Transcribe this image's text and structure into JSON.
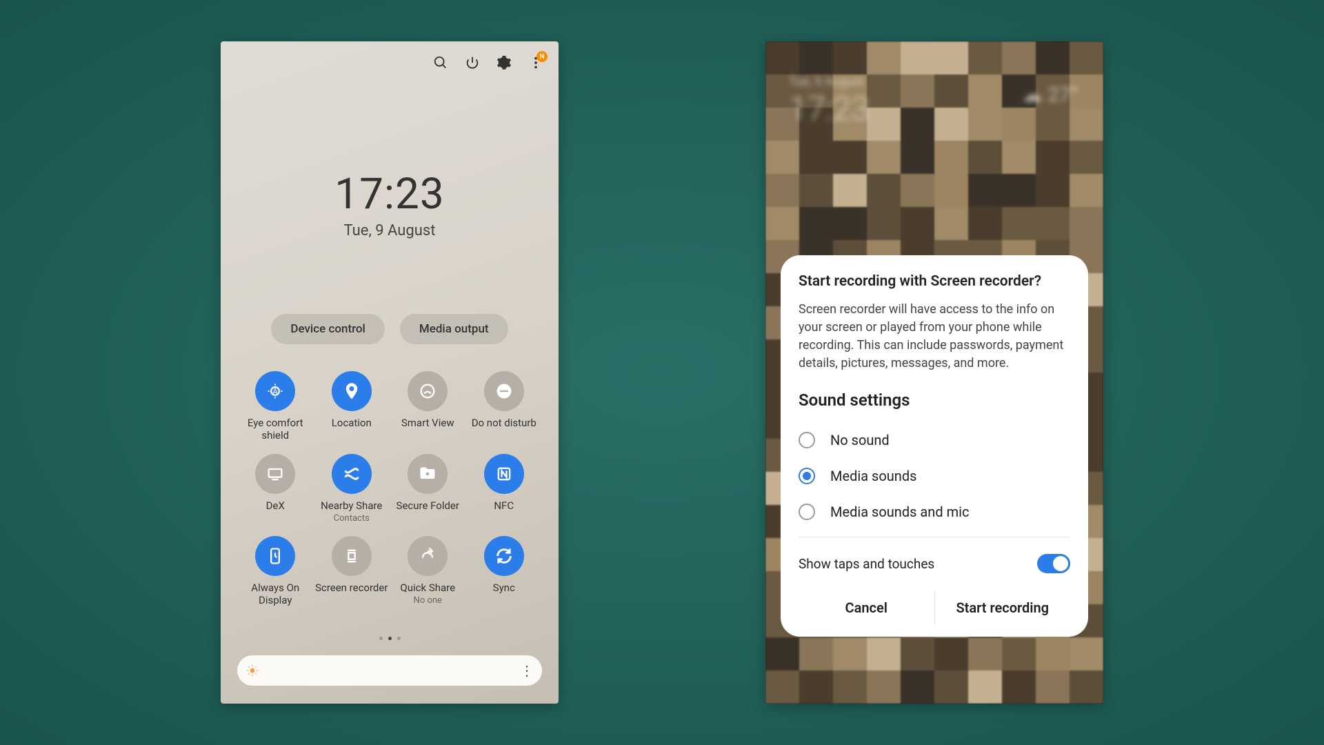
{
  "left": {
    "time": "17:23",
    "date": "Tue, 9 August",
    "badge": "N",
    "pills": {
      "device_control": "Device control",
      "media_output": "Media output"
    },
    "tiles": [
      {
        "label": "Eye comfort shield",
        "sub": "",
        "on": true,
        "icon": "eye"
      },
      {
        "label": "Location",
        "sub": "",
        "on": true,
        "icon": "location"
      },
      {
        "label": "Smart View",
        "sub": "",
        "on": false,
        "icon": "smartview"
      },
      {
        "label": "Do not disturb",
        "sub": "",
        "on": false,
        "icon": "dnd"
      },
      {
        "label": "DeX",
        "sub": "",
        "on": false,
        "icon": "dex"
      },
      {
        "label": "Nearby Share",
        "sub": "Contacts",
        "on": true,
        "icon": "nearby"
      },
      {
        "label": "Secure Folder",
        "sub": "",
        "on": false,
        "icon": "folder"
      },
      {
        "label": "NFC",
        "sub": "",
        "on": true,
        "icon": "nfc"
      },
      {
        "label": "Always On Display",
        "sub": "",
        "on": true,
        "icon": "aod"
      },
      {
        "label": "Screen recorder",
        "sub": "",
        "on": false,
        "icon": "record"
      },
      {
        "label": "Quick Share",
        "sub": "No one",
        "on": false,
        "icon": "quickshare"
      },
      {
        "label": "Sync",
        "sub": "",
        "on": true,
        "icon": "sync"
      }
    ]
  },
  "right": {
    "dialog_title": "Start recording with Screen recorder?",
    "dialog_body": "Screen recorder will have access to the info on your screen or played from your phone while recording. This can include passwords, payment details, pictures, messages, and more.",
    "sound_heading": "Sound settings",
    "options": {
      "no_sound": "No sound",
      "media": "Media sounds",
      "media_mic": "Media sounds and mic"
    },
    "selected": "media",
    "show_taps_label": "Show taps and touches",
    "show_taps": true,
    "cancel": "Cancel",
    "start": "Start recording"
  }
}
